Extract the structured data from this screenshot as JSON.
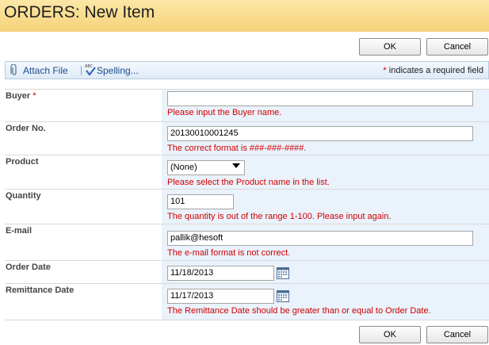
{
  "title": "ORDERS: New Item",
  "buttons": {
    "ok": "OK",
    "cancel": "Cancel"
  },
  "toolbar": {
    "attach": "Attach File",
    "separator": "|",
    "spelling": "Spelling...",
    "required_star": "*",
    "required_note": " indicates a required field"
  },
  "fields": {
    "buyer": {
      "label": "Buyer",
      "star": "*",
      "value": "",
      "error": "Please input the Buyer name."
    },
    "order_no": {
      "label": "Order No.",
      "value": "20130010001245",
      "error": "The correct format is ###-###-####."
    },
    "product": {
      "label": "Product",
      "value": "(None)",
      "error": "Please select the Product name in the list."
    },
    "quantity": {
      "label": "Quantity",
      "value": "101",
      "error": "The quantity is out of the range 1-100. Please input again."
    },
    "email": {
      "label": "E-mail",
      "value": "pallik@hesoft",
      "error": "The e-mail format is not correct."
    },
    "order_date": {
      "label": "Order Date",
      "value": "11/18/2013"
    },
    "remittance_date": {
      "label": "Remittance Date",
      "value": "11/17/2013",
      "error": "The Remittance Date should be greater than or equal to Order Date."
    }
  }
}
